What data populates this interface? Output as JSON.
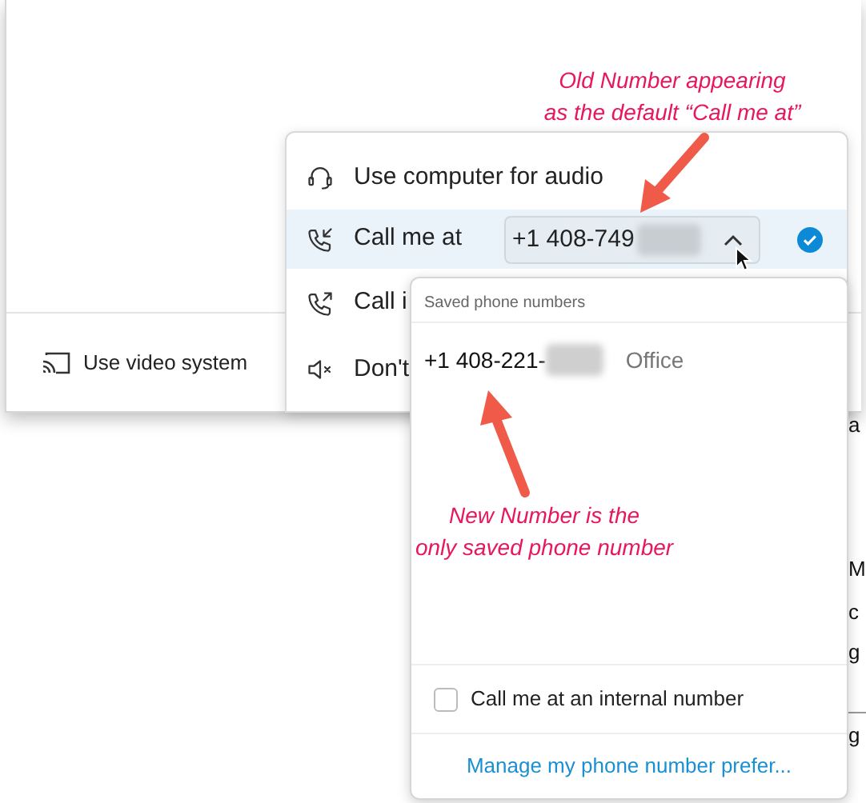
{
  "window": {
    "footer_button": "Use video system"
  },
  "background_fragments": [
    "a",
    "M",
    "c",
    "g",
    "g"
  ],
  "audio_menu": {
    "items": [
      {
        "kind": "computer",
        "label": "Use computer for audio",
        "selected": false
      },
      {
        "kind": "callme",
        "label": "Call me at",
        "selected": true,
        "number": "+1 408-749",
        "expanded": true
      },
      {
        "kind": "callin",
        "label": "Call i",
        "selected": false
      },
      {
        "kind": "mute",
        "label": "Don't",
        "selected": false
      }
    ]
  },
  "dropdown": {
    "header": "Saved phone numbers",
    "numbers": [
      {
        "number": "+1 408-221-",
        "label": "Office"
      }
    ],
    "internal": {
      "label": "Call me at an internal number",
      "checked": false
    },
    "link": "Manage my phone number prefer..."
  },
  "annotations": [
    {
      "lines": [
        "Old Number appearing",
        "as the default “Call me at”"
      ]
    },
    {
      "lines": [
        "New Number is the",
        "only saved phone number"
      ]
    }
  ]
}
